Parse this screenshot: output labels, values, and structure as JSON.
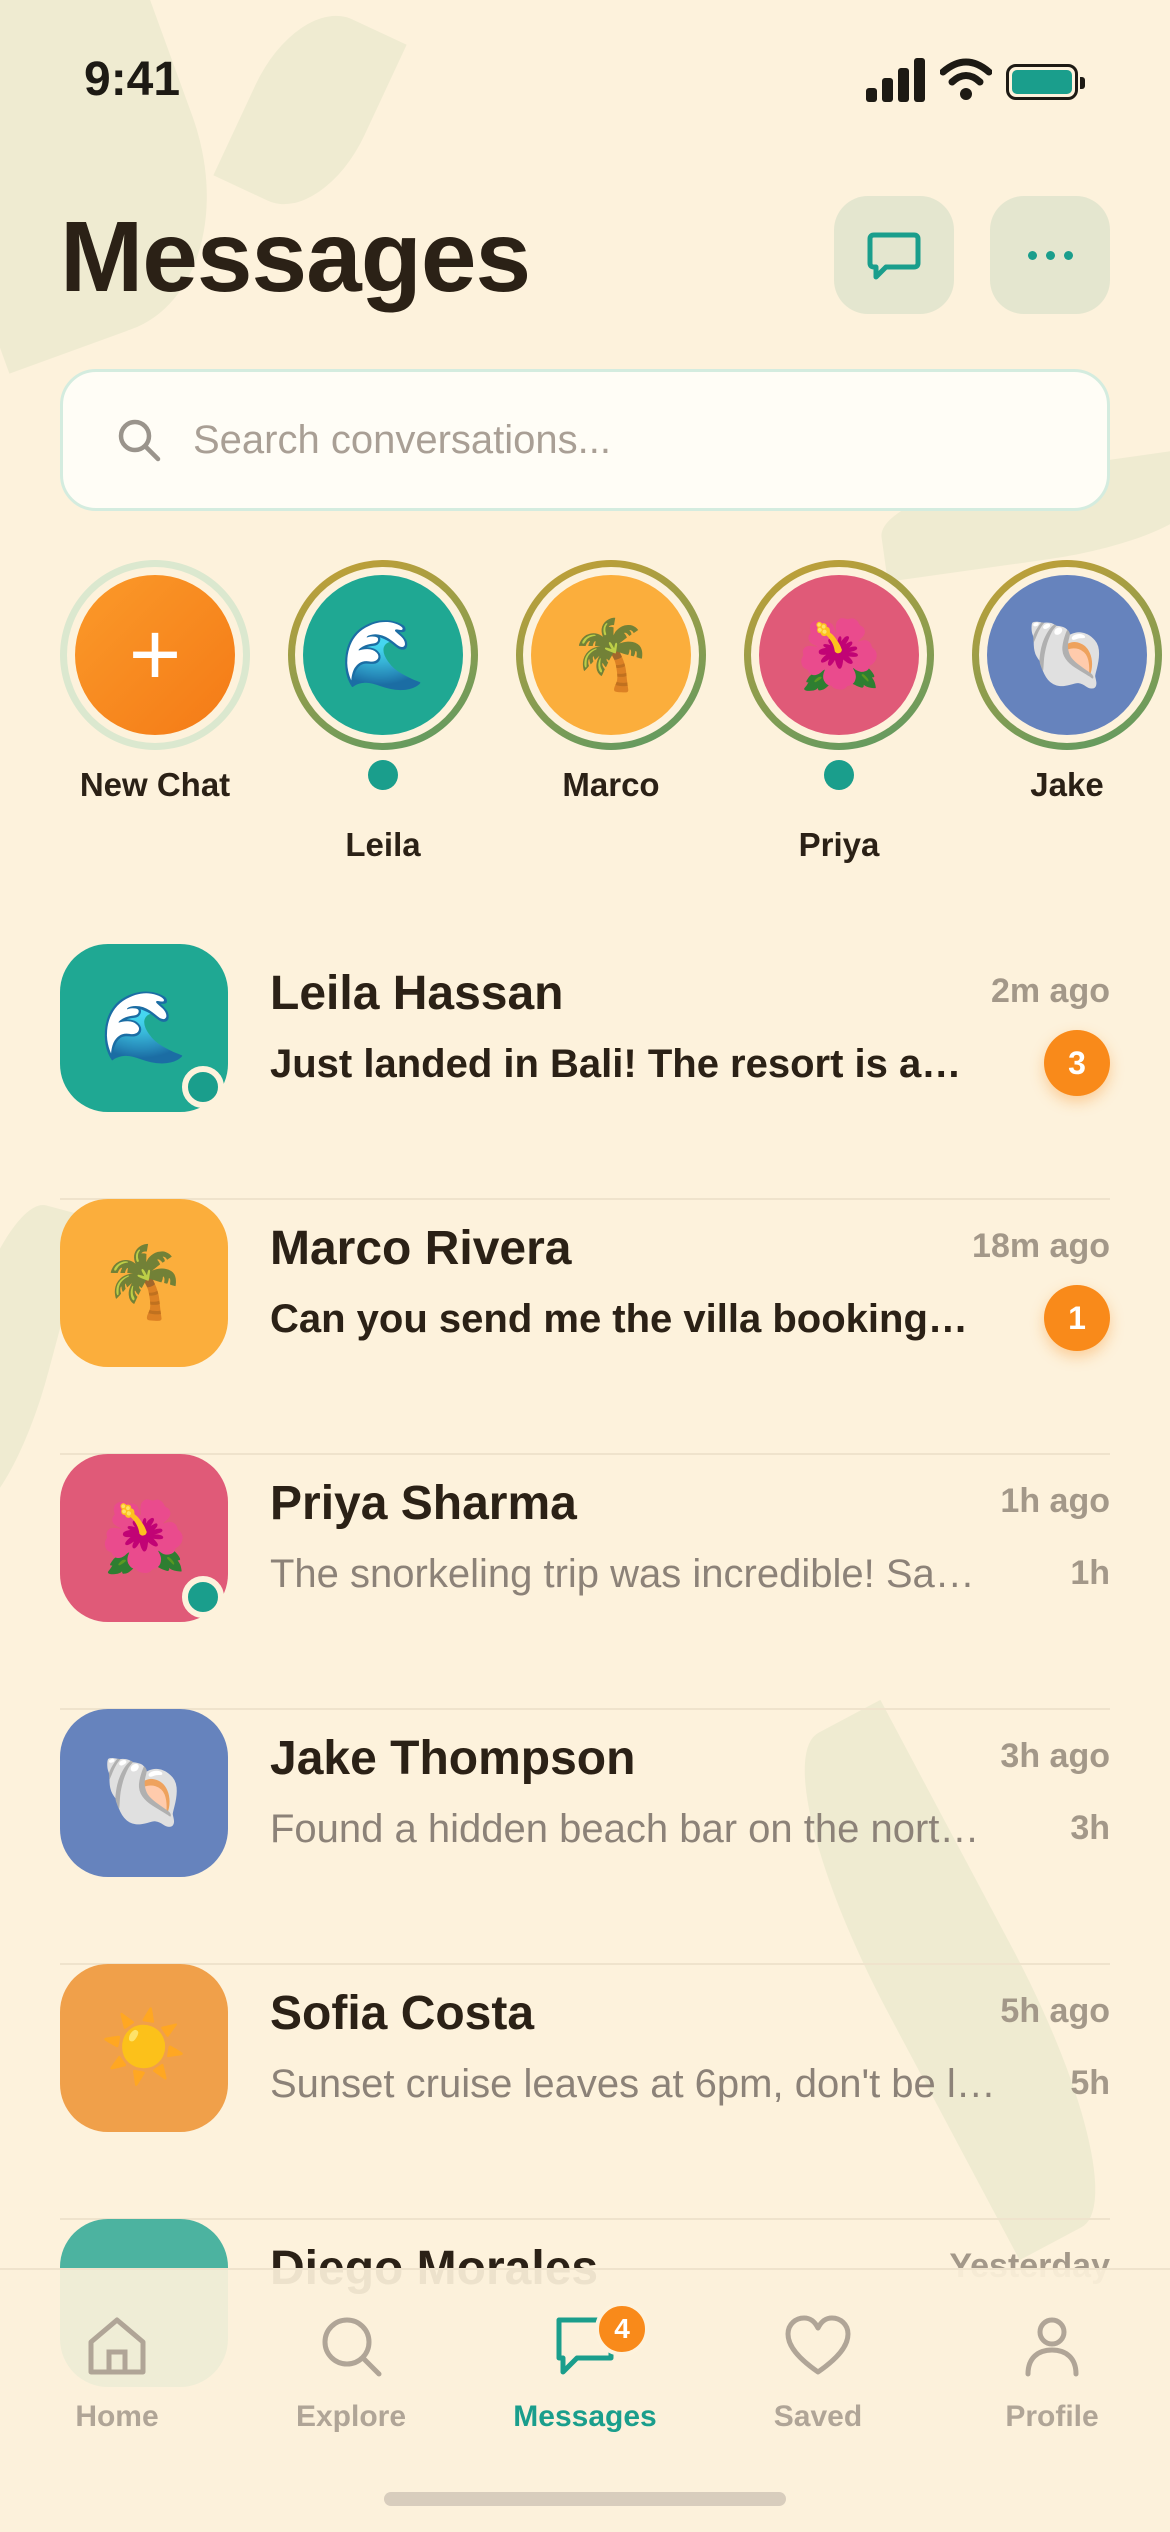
{
  "status_bar": {
    "time": "9:41"
  },
  "header": {
    "title": "Messages",
    "compose_icon": "chat-bubble-icon",
    "more_icon": "more-dots-icon"
  },
  "search": {
    "placeholder": "Search conversations...",
    "icon": "search-icon"
  },
  "stories": [
    {
      "label": "New Chat",
      "emoji": "+",
      "color": "#f98a1a",
      "online": false
    },
    {
      "label": "Leila",
      "emoji": "🌊",
      "color": "#1fa893",
      "online": true
    },
    {
      "label": "Marco",
      "emoji": "🌴",
      "color": "#fbae3c",
      "online": false
    },
    {
      "label": "Priya",
      "emoji": "🌺",
      "color": "#e05a78",
      "online": true
    },
    {
      "label": "Jake",
      "emoji": "🐚",
      "color": "#6683bd",
      "online": false
    }
  ],
  "conversations": [
    {
      "name": "Leila Hassan",
      "time": "2m ago",
      "message": "Just landed in Bali! The resort is a…",
      "unread": 3,
      "online": true,
      "emoji": "🌊",
      "color": "#1fa893"
    },
    {
      "name": "Marco Rivera",
      "time": "18m ago",
      "message": "Can you send me the villa booking…",
      "unread": 1,
      "online": false,
      "emoji": "🌴",
      "color": "#fbae3c"
    },
    {
      "name": "Priya Sharma",
      "time": "1h ago",
      "message": "The snorkeling trip was incredible! Sa…",
      "short_time": "1h",
      "online": true,
      "emoji": "🌺",
      "color": "#e05a78"
    },
    {
      "name": "Jake Thompson",
      "time": "3h ago",
      "message": "Found a hidden beach bar on the nort…",
      "short_time": "3h",
      "online": false,
      "emoji": "🐚",
      "color": "#6683bd"
    },
    {
      "name": "Sofia Costa",
      "time": "5h ago",
      "message": "Sunset cruise leaves at 6pm, don't be l…",
      "short_time": "5h",
      "online": false,
      "emoji": "☀️",
      "color": "#f0a04a"
    },
    {
      "name": "Diego Morales",
      "time": "Yesterday",
      "message": "",
      "online": false,
      "emoji": "",
      "color": "#4cb3a0"
    }
  ],
  "nav": {
    "items": [
      {
        "label": "Home",
        "icon": "home-icon"
      },
      {
        "label": "Explore",
        "icon": "explore-search-icon"
      },
      {
        "label": "Messages",
        "icon": "messages-icon",
        "badge": "4"
      },
      {
        "label": "Saved",
        "icon": "heart-icon"
      },
      {
        "label": "Profile",
        "icon": "profile-icon"
      }
    ]
  },
  "colors": {
    "accent": "#1a9e8c",
    "badge": "#f98a1a",
    "background": "#fdf2dc",
    "text": "#2b2116"
  }
}
